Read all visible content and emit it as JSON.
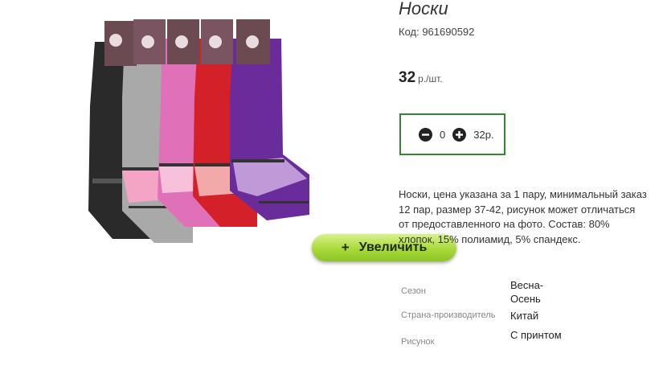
{
  "product": {
    "title": "Носки",
    "code": "Код: 961690592",
    "price_value": "32",
    "price_unit": "р./шт.",
    "image_alt": "Носки",
    "zoom_label": "Увеличить",
    "zoom_icon": "+"
  },
  "quantity": {
    "minus_icon": "minus-circle-icon",
    "plus_icon": "plus-circle-icon",
    "value": "0",
    "total": "32р."
  },
  "description": "Носки, цена указана за 1 пару, минимальный заказ 12 пар, размер 37-42, рисунок может отличаться от предоставленного на фото. Состав: 80% хлопок, 15% полиамид, 5% спандекс.",
  "properties": [
    {
      "label": "Сезон",
      "value": "Весна-Осень"
    },
    {
      "label": "Страна-производитель",
      "value": "Китай"
    },
    {
      "label": "Рисунок",
      "value": "С принтом"
    }
  ],
  "colors": {
    "frame_green": "#2f8a2f",
    "button_green": "#a9d93a",
    "sock_colors": [
      "#2a2a2a",
      "#a9a9a9",
      "#e070b8",
      "#d42028",
      "#6a2c9a"
    ]
  }
}
